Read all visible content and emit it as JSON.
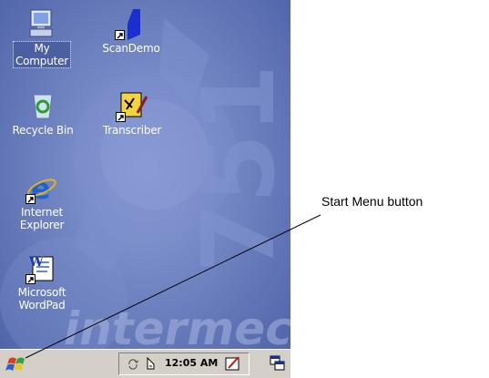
{
  "desktop": {
    "icons": [
      {
        "name": "my-computer",
        "label_line1": "My",
        "label_line2": "Computer"
      },
      {
        "name": "scandemo",
        "label_line1": "ScanDemo",
        "label_line2": ""
      },
      {
        "name": "recycle-bin",
        "label_line1": "Recycle Bin",
        "label_line2": ""
      },
      {
        "name": "transcriber",
        "label_line1": "Transcriber",
        "label_line2": ""
      },
      {
        "name": "internet-explorer",
        "label_line1": "Internet",
        "label_line2": "Explorer"
      },
      {
        "name": "wordpad",
        "label_line1": "Microsoft",
        "label_line2": "WordPad"
      }
    ],
    "wallpaper_brand": "intermec",
    "wallpaper_number": "751"
  },
  "taskbar": {
    "clock": "12:05 AM",
    "start_icon": "windows-flag-icon",
    "tray_icons": [
      "sync-icon",
      "network-icon",
      "input-panel-icon",
      "switch-window-icon"
    ]
  },
  "annotation": {
    "label": "Start Menu button"
  },
  "colors": {
    "wallpaper": "#5e73b8",
    "taskbar": "#d4d0c8",
    "label_text": "#ffffff"
  }
}
